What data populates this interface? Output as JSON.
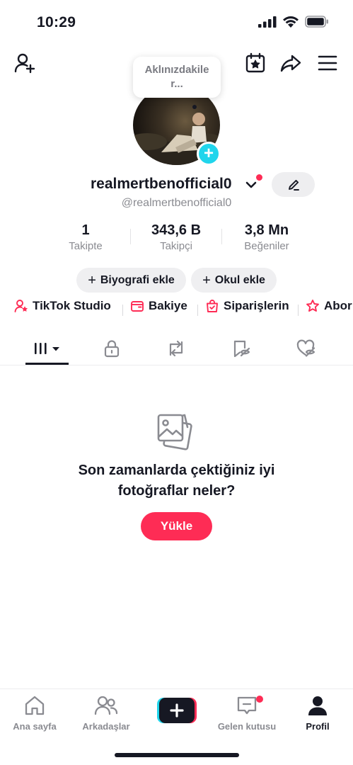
{
  "status_bar": {
    "time": "10:29"
  },
  "tooltip": {
    "text": "Aklınızdakiler..."
  },
  "profile": {
    "username": "realmertbenofficial0",
    "handle": "@realmertbenofficial0",
    "stats": [
      {
        "value": "1",
        "label": "Takipte"
      },
      {
        "value": "343,6 B",
        "label": "Takipçi"
      },
      {
        "value": "3,8 Mn",
        "label": "Beğeniler"
      }
    ],
    "pills": [
      {
        "label": "Biyografi ekle"
      },
      {
        "label": "Okul ekle"
      }
    ],
    "shortcuts": [
      {
        "label": "TikTok Studio",
        "icon": "person-star-icon"
      },
      {
        "label": "Bakiye",
        "icon": "wallet-icon"
      },
      {
        "label": "Siparişlerin",
        "icon": "shopping-bag-icon"
      },
      {
        "label": "Abor",
        "icon": "subscription-star-icon"
      }
    ]
  },
  "tabs": [
    {
      "name": "videos",
      "icon": "grid-icon",
      "active": true
    },
    {
      "name": "private",
      "icon": "lock-icon"
    },
    {
      "name": "reposts",
      "icon": "repost-icon"
    },
    {
      "name": "saved",
      "icon": "bookmark-hidden-icon"
    },
    {
      "name": "liked",
      "icon": "heart-hidden-icon"
    }
  ],
  "empty_state": {
    "title_line1": "Son zamanlarda çektiğiniz iyi",
    "title_line2": "fotoğraflar neler?",
    "button": "Yükle"
  },
  "bottom_nav": [
    {
      "label": "Ana sayfa",
      "icon": "home-icon"
    },
    {
      "label": "Arkadaşlar",
      "icon": "friends-icon"
    },
    {
      "label": "",
      "icon": "create-plus-icon"
    },
    {
      "label": "Gelen kutusu",
      "icon": "inbox-icon",
      "badge": true
    },
    {
      "label": "Profil",
      "icon": "profile-icon",
      "active": true
    }
  ],
  "colors": {
    "accent": "#fe2c55",
    "cyan": "#20d5ec",
    "text": "#161823",
    "muted": "#8a8b91"
  }
}
